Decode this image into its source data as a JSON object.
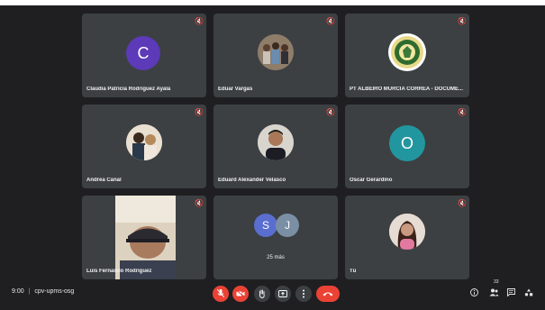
{
  "participants": [
    {
      "name": "Claudia Patricia Rodriguez Ayala",
      "initial": "C",
      "color": "#5c3ab8"
    },
    {
      "name": "Eduar Vargas"
    },
    {
      "name": "PT ALBEIRO MURCIA CORREA - DOCUME..."
    },
    {
      "name": "Andrea Canal"
    },
    {
      "name": "Eduard Alexander Velasco"
    },
    {
      "name": "Oscar Gerardino",
      "initial": "O",
      "color": "#22969e"
    },
    {
      "name": "Luis Fernando Rodríguez"
    },
    {
      "name": "25 más",
      "initials": [
        "S",
        "J"
      ],
      "colors": [
        "#5a6ed0",
        "#7a8fa3"
      ]
    },
    {
      "name": "Tú"
    }
  ],
  "controls": {
    "time": "9:00",
    "separator": "|",
    "meeting_code": "cpv-upms-osg",
    "participants_count": "33"
  },
  "icons": {
    "mic": "mic-muted-icon",
    "camera": "camera-off-icon",
    "hand": "raise-hand-icon",
    "present": "present-icon",
    "more": "more-options-icon",
    "end": "end-call-icon",
    "info": "info-icon",
    "people": "people-icon",
    "chat": "chat-icon",
    "activities": "activities-icon"
  }
}
